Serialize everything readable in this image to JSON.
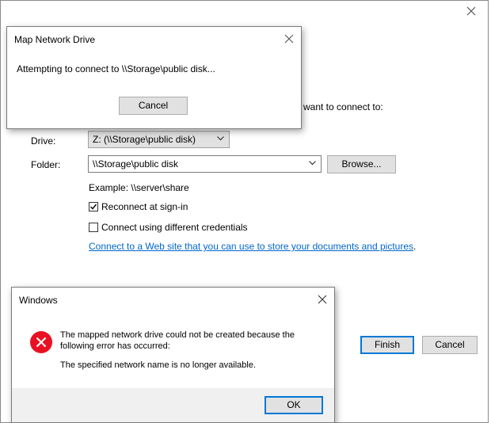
{
  "wizard": {
    "prompt_tail": "want to connect to:",
    "drive_label": "Drive:",
    "drive_value": "Z: (\\\\Storage\\public disk)",
    "folder_label": "Folder:",
    "folder_value": "\\\\Storage\\public disk",
    "browse_button": "Browse...",
    "example_text": "Example: \\\\server\\share",
    "reconnect_label": "Reconnect at sign-in",
    "reconnect_checked": true,
    "credentials_label": "Connect using different credentials",
    "credentials_checked": false,
    "web_link_text": "Connect to a Web site that you can use to store your documents and pictures",
    "web_link_period": ".",
    "finish_button": "Finish",
    "cancel_button": "Cancel"
  },
  "connecting_dialog": {
    "title": "Map Network Drive",
    "message": "Attempting to connect to \\\\Storage\\public disk...",
    "cancel_button": "Cancel"
  },
  "error_dialog": {
    "title": "Windows",
    "message_line1": "The mapped network drive could not be created because the",
    "message_line2": "following error has occurred:",
    "detail": "The specified network name is no longer available.",
    "ok_button": "OK",
    "icon": "error-icon",
    "icon_color": "#e81123"
  },
  "colors": {
    "accent": "#0078d7",
    "link": "#0066cc"
  }
}
